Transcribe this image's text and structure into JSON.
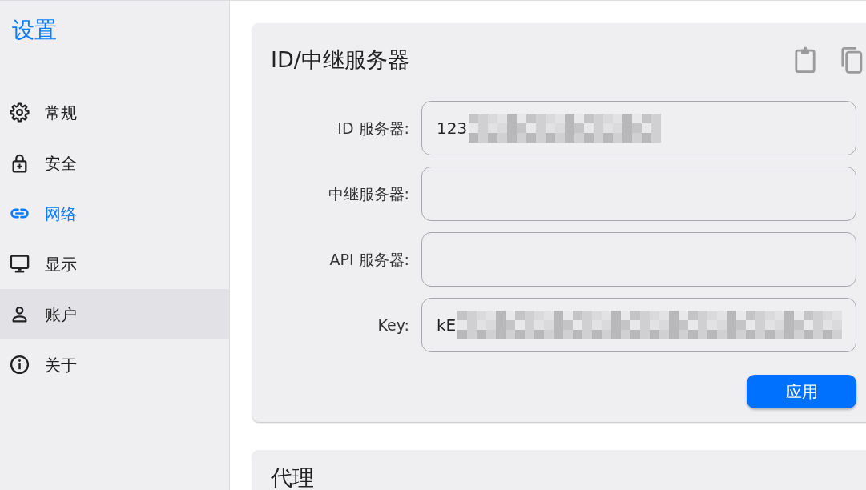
{
  "sidebar": {
    "title": "设置",
    "items": [
      {
        "label": "常规",
        "selected": false,
        "hovered": false
      },
      {
        "label": "安全",
        "selected": false,
        "hovered": false
      },
      {
        "label": "网络",
        "selected": true,
        "hovered": false
      },
      {
        "label": "显示",
        "selected": false,
        "hovered": false
      },
      {
        "label": "账户",
        "selected": false,
        "hovered": true
      },
      {
        "label": "关于",
        "selected": false,
        "hovered": false
      }
    ]
  },
  "sections": [
    {
      "title": "ID/中继服务器",
      "fields": [
        {
          "label": "ID 服务器:",
          "value": "123"
        },
        {
          "label": "中继服务器:"
        },
        {
          "label": "API 服务器:"
        },
        {
          "label": "Key:",
          "value": "kE"
        }
      ],
      "button": "应用"
    },
    {
      "title": "代理"
    }
  ]
}
